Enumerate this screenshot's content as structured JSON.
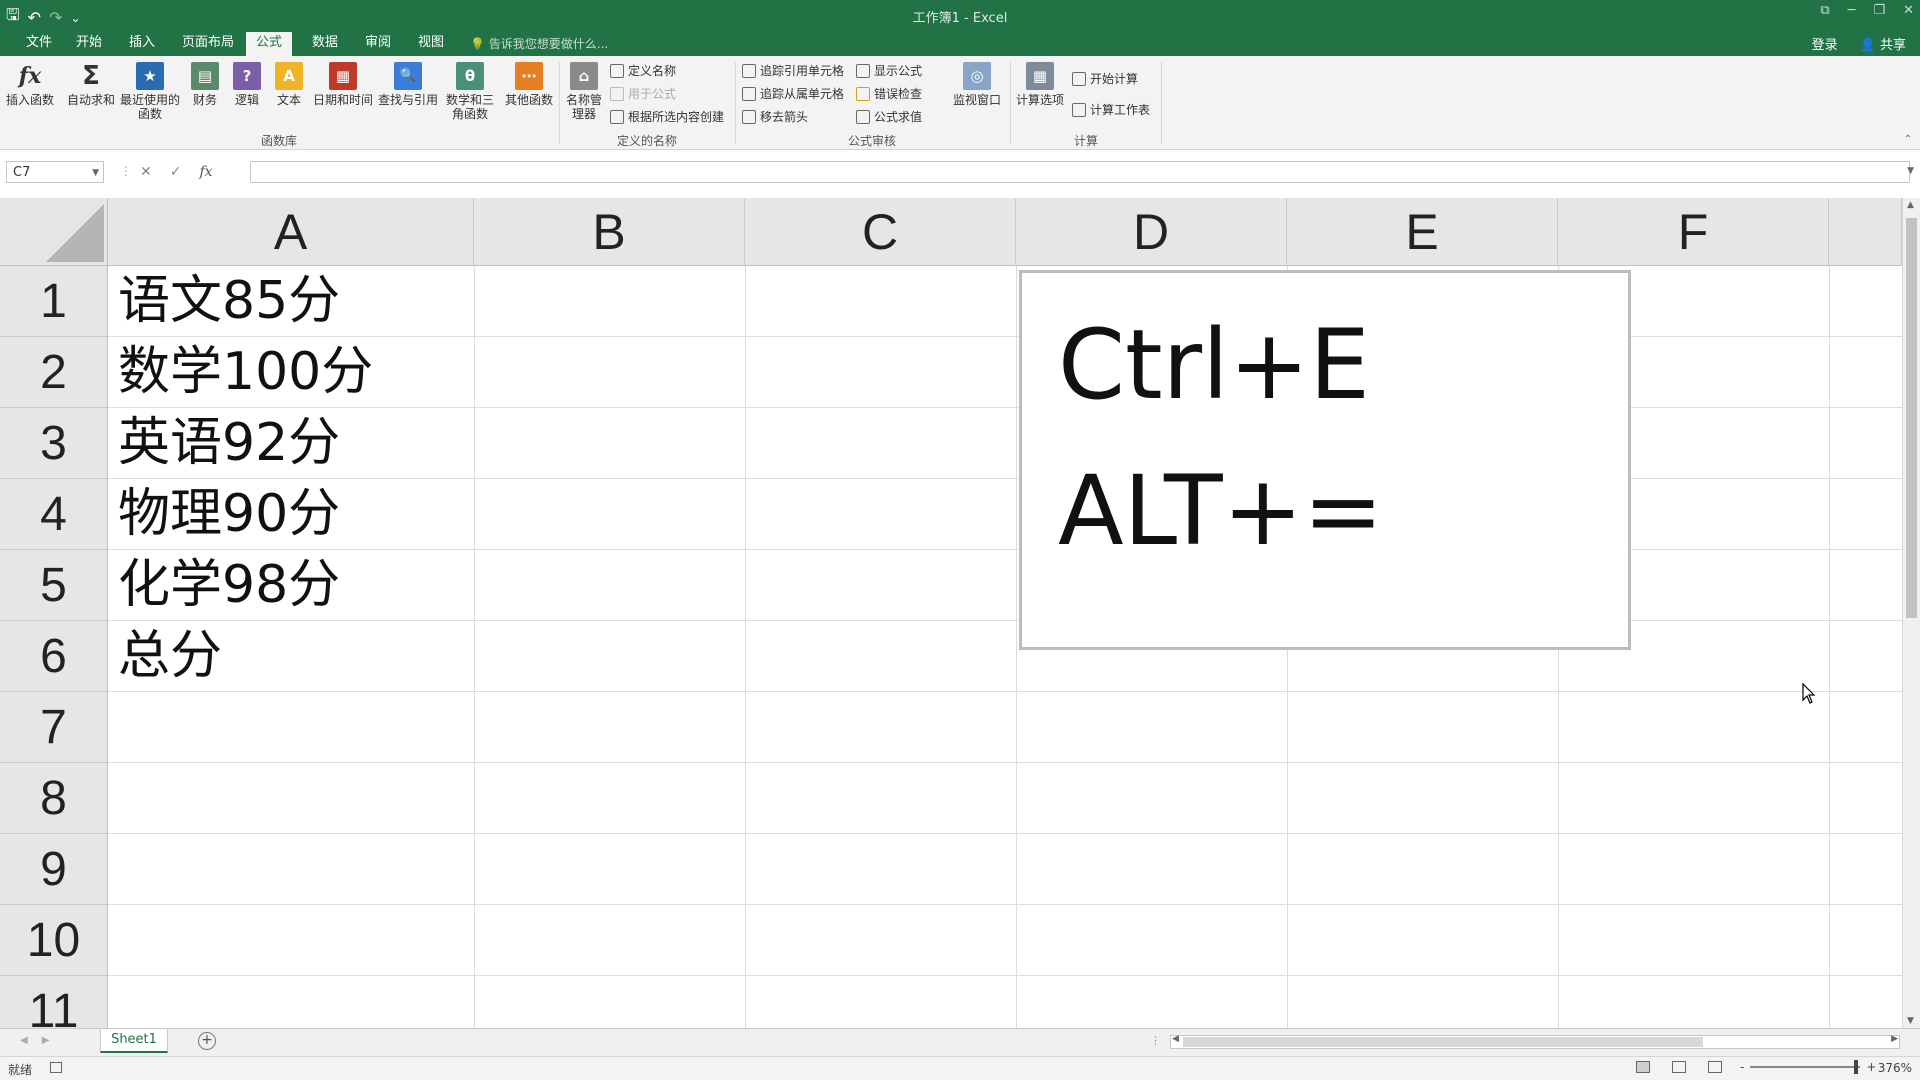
{
  "titlebar": {
    "title": "工作簿1 - Excel",
    "qat": {
      "save": "🖫",
      "undo": "↶",
      "redo": "↷",
      "more": "⌄"
    },
    "controls": {
      "restore": "⧉",
      "minimize": "─",
      "maximize": "❐",
      "close": "✕"
    }
  },
  "tabs": {
    "items": [
      "文件",
      "开始",
      "插入",
      "页面布局",
      "公式",
      "数据",
      "审阅",
      "视图"
    ],
    "active": "公式",
    "tell_me": "告诉我您想要做什么...",
    "login": "登录",
    "share": "共享"
  },
  "ribbon": {
    "function_library": {
      "label": "函数库",
      "buttons": [
        {
          "label": "插入函数",
          "icon": "fx"
        },
        {
          "label": "自动求和",
          "icon": "Σ"
        },
        {
          "label": "最近使用的函数",
          "icon": "★"
        },
        {
          "label": "财务",
          "icon": "▤"
        },
        {
          "label": "逻辑",
          "icon": "?"
        },
        {
          "label": "文本",
          "icon": "A"
        },
        {
          "label": "日期和时间",
          "icon": "▦"
        },
        {
          "label": "查找与引用",
          "icon": "🔍"
        },
        {
          "label": "数学和三角函数",
          "icon": "θ"
        },
        {
          "label": "其他函数",
          "icon": "⋯"
        }
      ]
    },
    "defined_names": {
      "label": "定义的名称",
      "name_manager": "名称管理器",
      "define_name": "定义名称",
      "use_in_formula": "用于公式",
      "create_from_selection": "根据所选内容创建"
    },
    "formula_auditing": {
      "label": "公式审核",
      "trace_precedents": "追踪引用单元格",
      "trace_dependents": "追踪从属单元格",
      "remove_arrows": "移去箭头",
      "show_formulas": "显示公式",
      "error_checking": "错误检查",
      "evaluate_formula": "公式求值",
      "watch_window": "监视窗口"
    },
    "calculation": {
      "label": "计算",
      "calc_options": "计算选项",
      "calc_now": "开始计算",
      "calc_sheet": "计算工作表"
    }
  },
  "formula_bar": {
    "name_box": "C7",
    "fx": "fx",
    "cancel": "✕",
    "enter": "✓",
    "value": ""
  },
  "grid": {
    "columns": [
      "A",
      "B",
      "C",
      "D",
      "E",
      "F"
    ],
    "rows": [
      "1",
      "2",
      "3",
      "4",
      "5",
      "6",
      "7",
      "8",
      "9",
      "10",
      "11"
    ],
    "cells_A": [
      "语文85分",
      "数学100分",
      "英语92分",
      "物理90分",
      "化学98分",
      "总分"
    ]
  },
  "shape": {
    "line1": "Ctrl+E",
    "line2": "ALT+="
  },
  "sheets": {
    "tabs": [
      "Sheet1"
    ],
    "add": "+"
  },
  "status": {
    "ready": "就绪",
    "zoom": "376%",
    "zoom_minus": "-",
    "zoom_plus": "+"
  }
}
